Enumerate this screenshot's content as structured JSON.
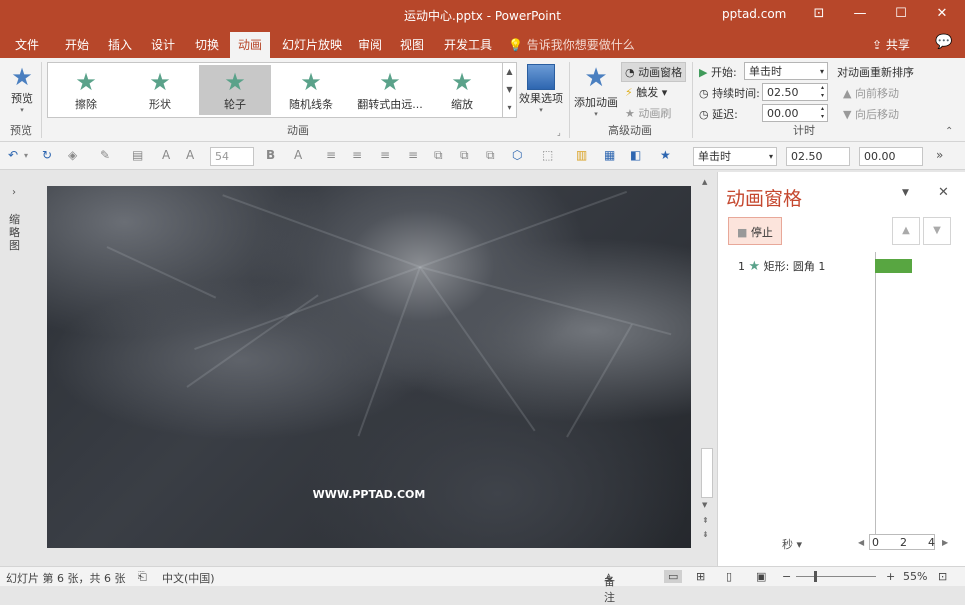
{
  "window": {
    "title": "运动中心.pptx - PowerPoint",
    "account": "pptad.com",
    "minimize": "—",
    "maximize": "☐",
    "close": "✕",
    "ribbon_display": "⊡"
  },
  "tabs": [
    {
      "label": "文件",
      "active": false
    },
    {
      "label": "开始",
      "active": false
    },
    {
      "label": "插入",
      "active": false
    },
    {
      "label": "设计",
      "active": false
    },
    {
      "label": "切换",
      "active": false
    },
    {
      "label": "动画",
      "active": true
    },
    {
      "label": "幻灯片放映",
      "active": false
    },
    {
      "label": "审阅",
      "active": false
    },
    {
      "label": "视图",
      "active": false
    },
    {
      "label": "开发工具",
      "active": false
    }
  ],
  "tellme": "告诉我你想要做什么",
  "share": "共享",
  "ribbon": {
    "preview": {
      "label": "预览",
      "group": "预览"
    },
    "gallery": {
      "items": [
        "擦除",
        "形状",
        "轮子",
        "随机线条",
        "翻转式由远...",
        "缩放"
      ],
      "selected": "轮子",
      "group": "动画"
    },
    "effect_options": "效果选项",
    "add_animation": "添加动画",
    "animation_pane": "动画窗格",
    "trigger": "触发",
    "animation_painter": "动画刷",
    "advanced_group": "高级动画",
    "start_label": "开始:",
    "start_value": "单击时",
    "duration_label": "持续时间:",
    "duration_value": "02.50",
    "delay_label": "延迟:",
    "delay_value": "00.00",
    "timing_group": "计时",
    "reorder_title": "对动画重新排序",
    "move_earlier": "向前移动",
    "move_later": "向后移动"
  },
  "qat": {
    "font_size": "54",
    "start": "单击时",
    "duration": "02.50",
    "delay": "00.00"
  },
  "left_strip": "缩略图",
  "slide": {
    "watermark": "WWW.PPTAD.COM"
  },
  "pane": {
    "title": "动画窗格",
    "stop": "停止",
    "items": [
      {
        "index": "1",
        "name": "矩形: 圆角 1"
      }
    ],
    "seconds": "秒",
    "ticks": [
      "0",
      "2",
      "4"
    ]
  },
  "status": {
    "slide": "幻灯片 第 6 张，共 6 张",
    "language": "中文(中国)",
    "notes": "备注",
    "zoom": "55%"
  }
}
